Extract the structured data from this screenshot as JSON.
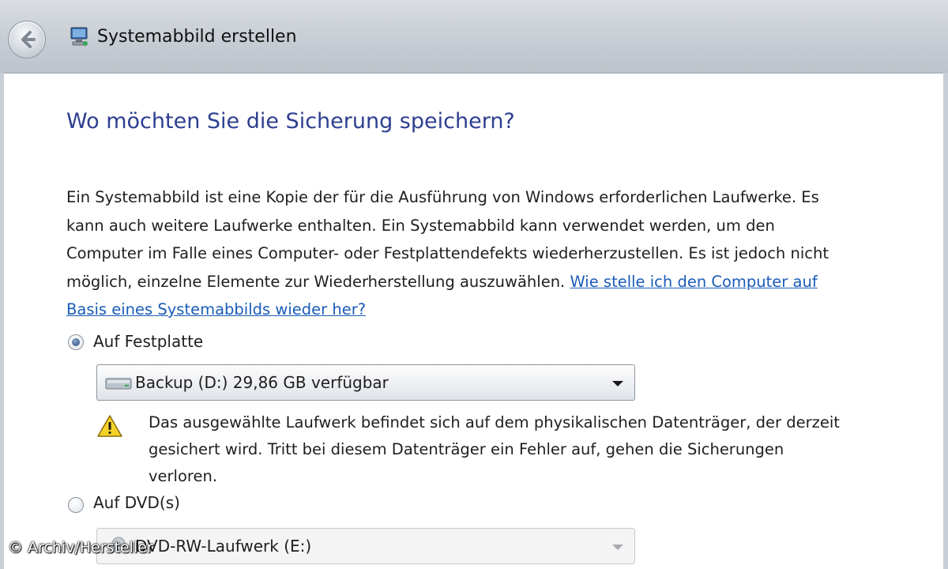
{
  "window": {
    "title": "Systemabbild erstellen",
    "back_icon": "back-arrow-icon",
    "app_icon": "system-image-icon"
  },
  "heading": "Wo möchten Sie die Sicherung speichern?",
  "description": {
    "lines": [
      "Ein Systemabbild ist eine Kopie der für die Ausführung von Windows erforderlichen Laufwerke. Es",
      "kann auch weitere Laufwerke enthalten. Ein Systemabbild kann verwendet werden, um den",
      "Computer im Falle eines Computer- oder Festplattendefekts wiederherzustellen. Es ist jedoch nicht",
      "möglich, einzelne Elemente zur Wiederherstellung auszuwählen."
    ],
    "link_line1": "Wie stelle ich den Computer auf",
    "link_line2": "Basis eines Systemabbilds wieder her?"
  },
  "options": {
    "harddisk": {
      "label": "Auf Festplatte",
      "selected": true,
      "dropdown": {
        "value": "Backup (D:)  29,86 GB verfügbar",
        "icon": "hard-drive-icon"
      },
      "warning": {
        "icon": "warning-icon",
        "lines": [
          "Das ausgewählte Laufwerk befindet sich auf dem physikalischen Datenträger, der derzeit",
          "gesichert wird. Tritt bei diesem Datenträger ein Fehler auf, gehen die Sicherungen",
          "verloren."
        ]
      }
    },
    "dvd": {
      "label": "Auf DVD(s)",
      "selected": false,
      "dropdown": {
        "value": "DVD-RW-Laufwerk (E:)",
        "icon": "dvd-drive-icon",
        "disabled": true
      }
    }
  },
  "watermark": "© Archiv/Hersteller",
  "colors": {
    "heading": "#2d3f8f",
    "link": "#1a5bb8",
    "titlebar": "#c6ccd3"
  }
}
